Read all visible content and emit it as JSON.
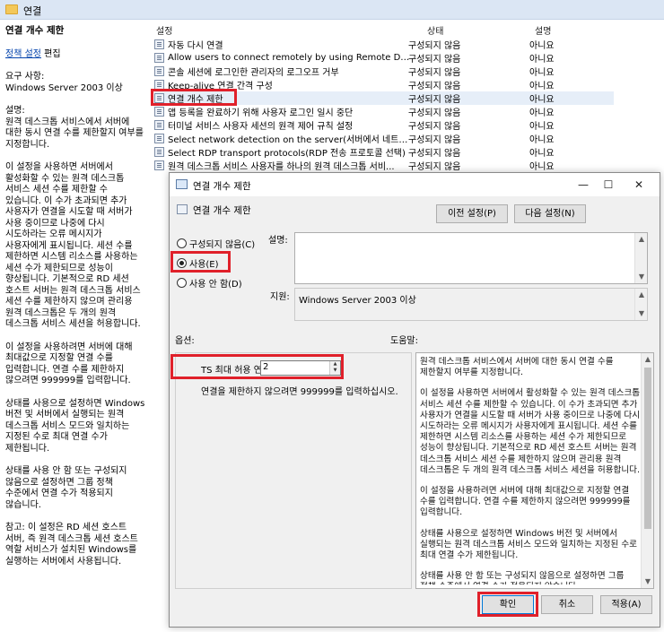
{
  "window": {
    "title": "연결"
  },
  "left_pane": {
    "title": "연결 개수 제한",
    "policy_link": "정책 설정",
    "edit": "편집",
    "requirements_label": "요구 사항:",
    "requirements_value": "Windows Server 2003 이상",
    "description_label": "설명:",
    "paragraphs": [
      "원격 데스크톱 서비스에서 서버에 대한 동시 연결 수를 제한할지 여부를 지정합니다.",
      "이 설정을 사용하면 서버에서 활성화할 수 있는 원격 데스크톱 서비스 세션 수를 제한할 수 있습니다. 이 수가 초과되면 추가 사용자가 연결을 시도할 때 서버가 사용 중이므로 나중에 다시 시도하라는 오류 메시지가 사용자에게 표시됩니다. 세션 수를 제한하면 시스템 리소스를 사용하는 세션 수가 제한되므로 성능이 향상됩니다. 기본적으로 RD 세션 호스트 서버는 원격 데스크톱 서비스 세션 수를 제한하지 않으며 관리용 원격 데스크톱은 두 개의 원격 데스크톱 서비스 세션을 허용합니다.",
      "이 설정을 사용하려면 서버에 대해 최대값으로 지정할 연결 수를 입력합니다. 연결 수를 제한하지 않으려면 999999를 입력합니다.",
      "상태를 사용으로 설정하면 Windows 버전 및 서버에서 실행되는 원격 데스크톱 서비스 모드와 일치하는 지정된 수로 최대 연결 수가 제한됩니다.",
      "상태를 사용 안 함 또는 구성되지 않음으로 설정하면 그룹 정책 수준에서 연결 수가 적용되지 않습니다.",
      "참고: 이 설정은 RD 세션 호스트 서버, 즉 원격 데스크톱 세션 호스트 역할 서비스가 설치된 Windows를 실행하는 서버에서 사용됩니다."
    ]
  },
  "table": {
    "headers": {
      "setting": "설정",
      "state": "상태",
      "comment": "설명"
    },
    "rows": [
      {
        "name": "자동 다시 연결",
        "state": "구성되지 않음",
        "comment": "아니요"
      },
      {
        "name": "Allow users to connect remotely by using Remote Desktop...",
        "state": "구성되지 않음",
        "comment": "아니요"
      },
      {
        "name": "콘솔 세션에 로그인한 관리자의 로그오프 거부",
        "state": "구성되지 않음",
        "comment": "아니요"
      },
      {
        "name": "Keep-alive 연결 간격 구성",
        "state": "구성되지 않음",
        "comment": "아니요"
      },
      {
        "name": "연결 개수 제한",
        "state": "구성되지 않음",
        "comment": "아니요"
      },
      {
        "name": "앱 등록을 완료하기 위해 사용자 로그인 일시 중단",
        "state": "구성되지 않음",
        "comment": "아니요"
      },
      {
        "name": "터미널 서비스 사용자 세션의 원격 제어 규칙 설정",
        "state": "구성되지 않음",
        "comment": "아니요"
      },
      {
        "name": "Select network detection on the server(서버에서 네트워크 ...",
        "state": "구성되지 않음",
        "comment": "아니요"
      },
      {
        "name": "Select RDP transport protocols(RDP 전송 프로토콜 선택)",
        "state": "구성되지 않음",
        "comment": "아니요"
      },
      {
        "name": "원격 데스크톱 서비스 사용자를 하나의 원격 데스크톱 서비...",
        "state": "구성되지 않음",
        "comment": "아니요"
      }
    ]
  },
  "dialog": {
    "title": "연결 개수 제한",
    "header_name": "연결 개수 제한",
    "prev_button": "이전 설정(P)",
    "next_button": "다음 설정(N)",
    "radios": {
      "not_configured": "구성되지 않음(C)",
      "enabled": "사용(E)",
      "disabled": "사용 안 함(D)",
      "selected": "enabled"
    },
    "comment_label": "설명:",
    "supported_label": "지원:",
    "supported_value": "Windows Server 2003 이상",
    "options_label": "옵션:",
    "help_label": "도움말:",
    "option_field_label": "TS 최대 허용 연결",
    "option_value": "2",
    "option_hint": "연결을 제한하지 않으려면 999999를 입력하십시오.",
    "help_paragraphs": [
      "원격 데스크톱 서비스에서 서버에 대한 동시 연결 수를 제한할지 여부를 지정합니다.",
      "이 설정을 사용하면 서버에서 활성화할 수 있는 원격 데스크톱 서비스 세션 수를 제한할 수 있습니다. 이 수가 초과되면 추가 사용자가 연결을 시도할 때 서버가 사용 중이므로 나중에 다시 시도하라는 오류 메시지가 사용자에게 표시됩니다. 세션 수를 제한하면 시스템 리소스를 사용하는 세션 수가 제한되므로 성능이 향상됩니다. 기본적으로 RD 세션 호스트 서버는 원격 데스크톱 서비스 세션 수를 제한하지 않으며 관리용 원격 데스크톱은 두 개의 원격 데스크톱 서비스 세션을 허용합니다.",
      "이 설정을 사용하려면 서버에 대해 최대값으로 지정할 연결 수를 입력합니다. 연결 수를 제한하지 않으려면 999999를 입력합니다.",
      "상태를 사용으로 설정하면 Windows 버전 및 서버에서 실행되는 원격 데스크톱 서비스 모드와 일치하는 지정된 수로 최대 연결 수가 제한됩니다.",
      "상태를 사용 안 함 또는 구성되지 않음으로 설정하면 그룹 정책 수준에서 연결 수가 적용되지 않습니다."
    ],
    "ok_button": "확인",
    "cancel_button": "취소",
    "apply_button": "적용(A)"
  },
  "colors": {
    "highlight": "#e0202a",
    "selected_row": "#e6eef8",
    "link": "#0645ad"
  }
}
